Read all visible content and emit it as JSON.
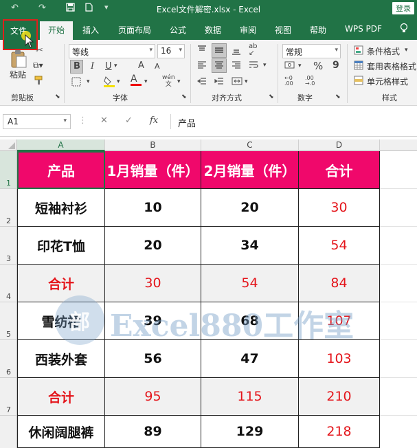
{
  "window": {
    "title": "Excel文件解密.xlsx  -  Excel",
    "login": "登录"
  },
  "quick_access": {
    "undo": "↶",
    "redo": "↷",
    "save": "💾",
    "new": "🗋",
    "customize": "▾"
  },
  "tabs": [
    {
      "label": "文件"
    },
    {
      "label": "开始"
    },
    {
      "label": "插入"
    },
    {
      "label": "页面布局"
    },
    {
      "label": "公式"
    },
    {
      "label": "数据"
    },
    {
      "label": "审阅"
    },
    {
      "label": "视图"
    },
    {
      "label": "帮助"
    },
    {
      "label": "WPS PDF"
    }
  ],
  "ribbon": {
    "clipboard": {
      "paste": "粘贴",
      "label": "剪贴板"
    },
    "font": {
      "name": "等线",
      "size": "16",
      "bold": "B",
      "italic": "I",
      "underline": "U",
      "grow": "A",
      "shrink": "A",
      "phonetic": "wén",
      "label": "字体"
    },
    "alignment": {
      "label": "对齐方式"
    },
    "number": {
      "format": "常规",
      "percent": "%",
      "comma": "9",
      "label": "数字"
    },
    "styles": {
      "conditional": "条件格式",
      "table": "套用表格格式",
      "cell": "单元格样式",
      "label": "样式"
    }
  },
  "formula_bar": {
    "name_box": "A1",
    "fx": "fx",
    "cancel": "✕",
    "enter": "✓",
    "content": "产品"
  },
  "columns": [
    "A",
    "B",
    "C",
    "D"
  ],
  "rows": [
    "1",
    "2",
    "3",
    "4",
    "5",
    "6",
    "7"
  ],
  "sheet": {
    "header": [
      "产品",
      "1月销量（件）",
      "2月销量（件）",
      "合计"
    ],
    "data": [
      [
        "短袖衬衫",
        "10",
        "20",
        "30"
      ],
      [
        "印花T恤",
        "20",
        "34",
        "54"
      ],
      [
        "合计",
        "30",
        "54",
        "84"
      ],
      [
        "雪纺裙",
        "39",
        "68",
        "107"
      ],
      [
        "西装外套",
        "56",
        "47",
        "103"
      ],
      [
        "合计",
        "95",
        "115",
        "210"
      ],
      [
        "休闲阔腿裤",
        "89",
        "129",
        "218"
      ]
    ]
  },
  "watermark": {
    "logo": "部",
    "text": "Excel880工作室"
  },
  "colors": {
    "brand": "#217346",
    "header_fill": "#f0086b",
    "red_text": "#e4151b",
    "highlight_box": "#e0201b"
  }
}
